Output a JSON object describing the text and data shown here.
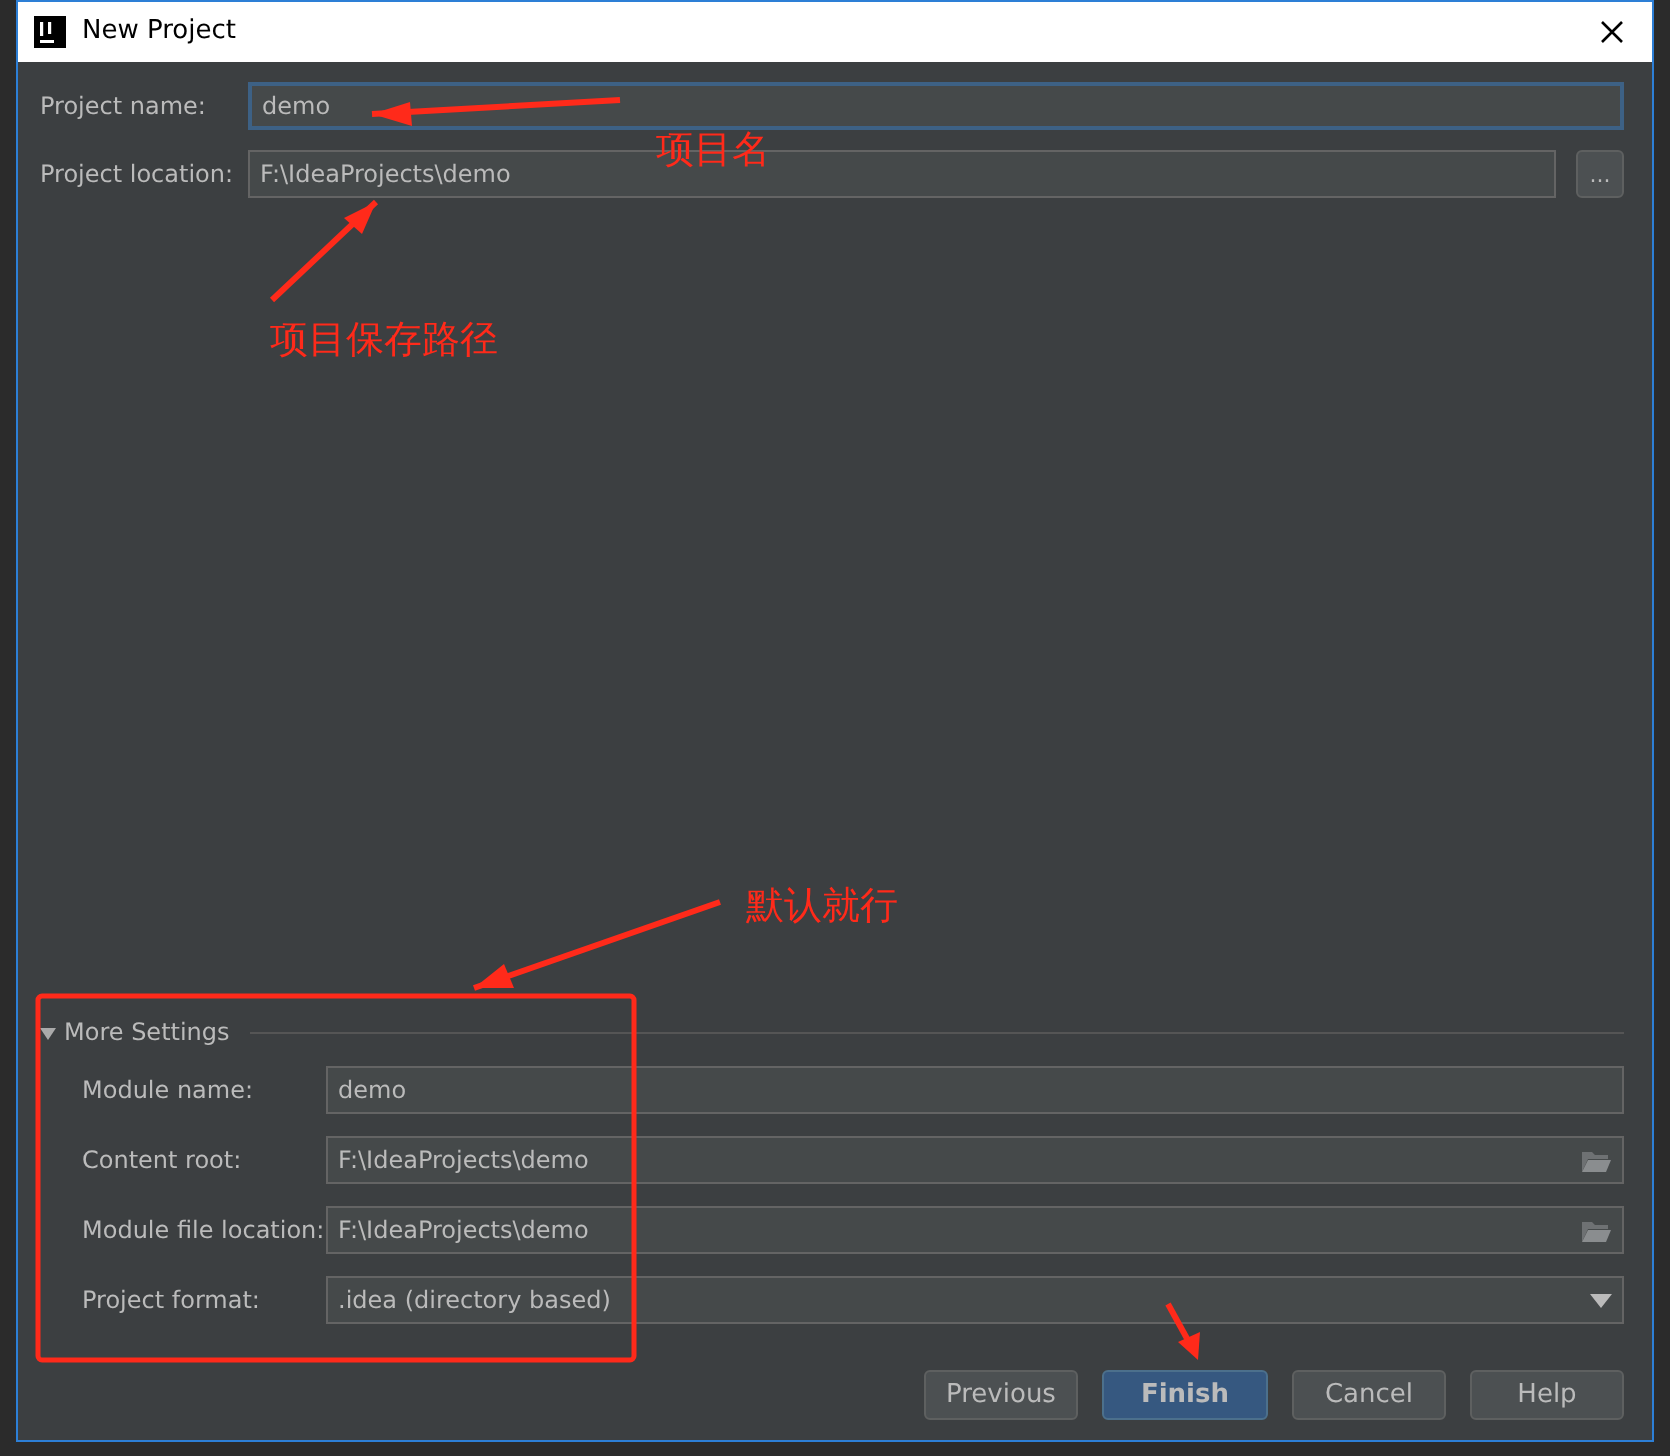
{
  "window": {
    "title": "New Project"
  },
  "project_fields": [
    {
      "kind": "text",
      "label": "Project name:",
      "value": "demo",
      "focused": true
    },
    {
      "kind": "browse",
      "label": "Project location:",
      "value": "F:\\IdeaProjects\\demo",
      "button": "..."
    }
  ],
  "more_settings": {
    "title": "More Settings",
    "expanded": true,
    "fields": [
      {
        "kind": "text",
        "label": "Module name:",
        "value": "demo"
      },
      {
        "kind": "folder",
        "label": "Content root:",
        "value": "F:\\IdeaProjects\\demo"
      },
      {
        "kind": "folder",
        "label": "Module file location:",
        "value": "F:\\IdeaProjects\\demo"
      },
      {
        "kind": "select",
        "label": "Project format:",
        "value": ".idea (directory based)"
      }
    ]
  },
  "buttons": [
    {
      "label": "Previous",
      "default": false
    },
    {
      "label": "Finish",
      "default": true
    },
    {
      "label": "Cancel",
      "default": false
    },
    {
      "label": "Help",
      "default": false
    }
  ],
  "annotations": [
    {
      "kind": "arrow-label",
      "text": "项目名"
    },
    {
      "kind": "arrow-label",
      "text": "项目保存路径"
    },
    {
      "kind": "arrow-label",
      "text": "默认就行"
    },
    {
      "kind": "frame"
    },
    {
      "kind": "arrow"
    }
  ]
}
